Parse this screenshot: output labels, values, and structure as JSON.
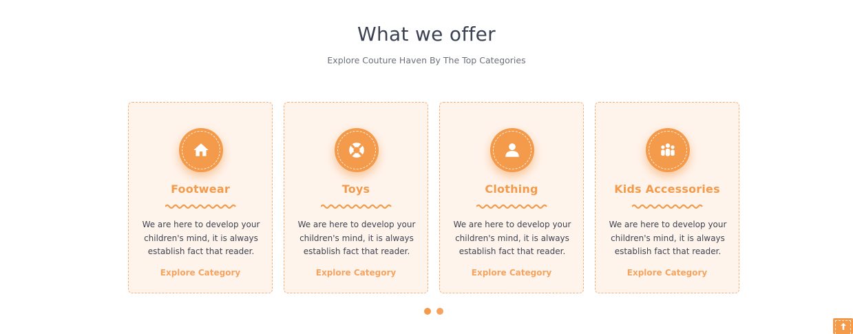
{
  "header": {
    "title": "What we offer",
    "subtitle": "Explore Couture Haven By The Top Categories"
  },
  "cards": [
    {
      "icon": "home-icon",
      "title": "Footwear",
      "description": "We are here to develop your children's mind, it is always establish fact that reader.",
      "link": "Explore Category"
    },
    {
      "icon": "lifebuoy-icon",
      "title": "Toys",
      "description": "We are here to develop your children's mind, it is always establish fact that reader.",
      "link": "Explore Category"
    },
    {
      "icon": "user-icon",
      "title": "Clothing",
      "description": "We are here to develop your children's mind, it is always establish fact that reader.",
      "link": "Explore Category"
    },
    {
      "icon": "group-icon",
      "title": "Kids Accessories",
      "description": "We are here to develop your children's mind, it is always establish fact that reader.",
      "link": "Explore Category"
    }
  ],
  "carousel": {
    "page_count": 2,
    "active_page": 1
  },
  "scroll_top": {
    "icon": "arrow-up-icon"
  },
  "colors": {
    "accent": "#f39a4b",
    "card_background": "#fff4ec",
    "heading": "#3a4150",
    "body_text": "#3d4250"
  }
}
